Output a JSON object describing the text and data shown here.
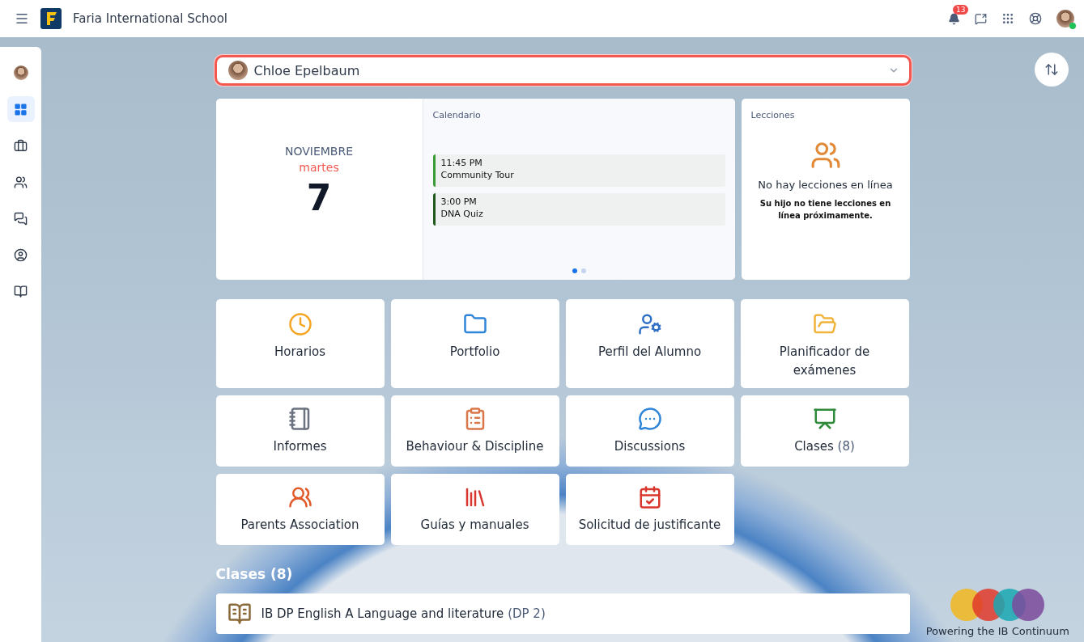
{
  "header": {
    "school": "Faria International School",
    "notifications": "13"
  },
  "sidebar": {
    "items": [
      {
        "kind": "avatar",
        "selected": false
      },
      {
        "kind": "grid",
        "selected": true
      },
      {
        "kind": "briefcase",
        "selected": false
      },
      {
        "kind": "people",
        "selected": false
      },
      {
        "kind": "chat",
        "selected": false
      },
      {
        "kind": "profile",
        "selected": false
      },
      {
        "kind": "book",
        "selected": false
      }
    ]
  },
  "student_select": {
    "value": "Chloe Epelbaum"
  },
  "date": {
    "month": "NOVIEMBRE",
    "weekday": "martes",
    "day": "7"
  },
  "calendar": {
    "title": "Calendario",
    "events": [
      {
        "time": "11:45 PM",
        "title": "Community Tour",
        "color": "#3a9b35"
      },
      {
        "time": "3:00 PM",
        "title": "DNA Quiz",
        "color": "#1f5a1c"
      }
    ],
    "pages": [
      {
        "selected": true
      },
      {
        "selected": false
      }
    ]
  },
  "lessons": {
    "title": "Lecciones",
    "empty_title": "No hay lecciones en línea",
    "empty_text": "Su hijo no tiene lecciones en línea próximamente."
  },
  "tiles": [
    {
      "label": "Horarios"
    },
    {
      "label": "Portfolio"
    },
    {
      "label": "Perfil del Alumno"
    },
    {
      "label": "Planificador de exámenes"
    },
    {
      "label": "Informes"
    },
    {
      "label": "Behaviour & Discipline"
    },
    {
      "label": "Discussions"
    },
    {
      "label": "Clases",
      "count": "(8)"
    },
    {
      "label": "Parents Association"
    },
    {
      "label": "Guías y manuales"
    },
    {
      "label": "Solicitud de justificante"
    }
  ],
  "classes": {
    "title": "Clases (8)",
    "items": [
      {
        "name": "IB DP English A Language and literature",
        "grade": "(DP 2)"
      }
    ]
  },
  "footer_logo": {
    "text": "Powering the IB Continuum"
  }
}
